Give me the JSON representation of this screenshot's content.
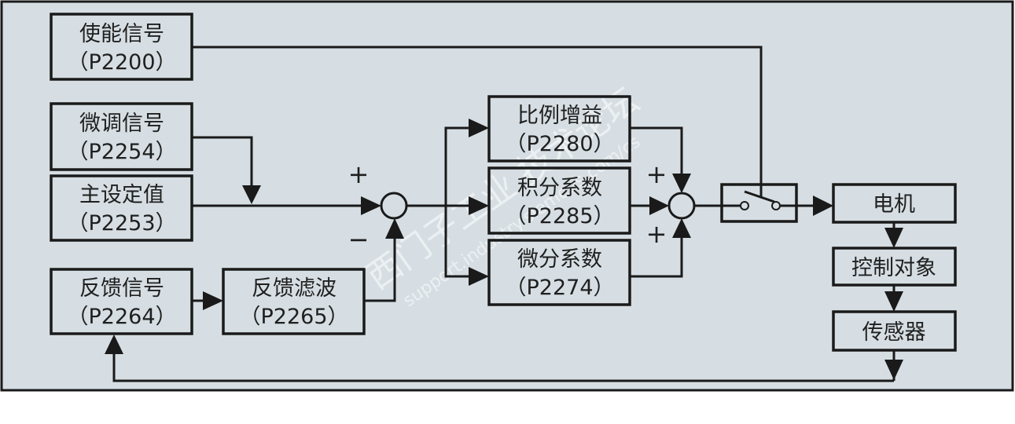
{
  "colors": {
    "background": "#d6dee3",
    "line": "#1a1a1a",
    "frame": "#1a1a1a"
  },
  "blocks": {
    "enable": {
      "title": "使能信号",
      "param": "（P2200）"
    },
    "trim": {
      "title": "微调信号",
      "param": "（P2254）"
    },
    "setpoint": {
      "title": "主设定值",
      "param": "（P2253）"
    },
    "feedback": {
      "title": "反馈信号",
      "param": "（P2264）"
    },
    "filter": {
      "title": "反馈滤波",
      "param": "（P2265）"
    },
    "proportional": {
      "title": "比例增益",
      "param": "（P2280）"
    },
    "integral": {
      "title": "积分系数",
      "param": "（P2285）"
    },
    "derivative": {
      "title": "微分系数",
      "param": "（P2274）"
    },
    "motor": {
      "title": "电机"
    },
    "plant": {
      "title": "控制对象"
    },
    "sensor": {
      "title": "传感器"
    }
  },
  "signs": {
    "sum1_plus": "+",
    "sum1_minus": "−",
    "sum2_plus_top": "+",
    "sum2_plus_bottom": "+"
  },
  "watermark": {
    "cn": "西门子工业 技术论坛",
    "url": "support.industry.siemens.com/cs"
  }
}
